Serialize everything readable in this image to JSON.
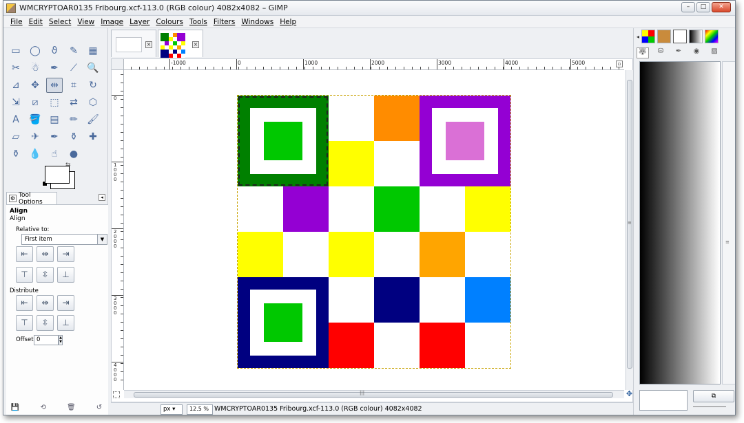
{
  "window": {
    "title": "WMCRYPTOAR0135 Fribourg.xcf-113.0 (RGB colour) 4082x4082 – GIMP",
    "controls": {
      "minimize": "–",
      "maximize": "□",
      "close": "✕"
    }
  },
  "menubar": {
    "items": [
      "File",
      "Edit",
      "Select",
      "View",
      "Image",
      "Layer",
      "Colours",
      "Tools",
      "Filters",
      "Windows",
      "Help"
    ]
  },
  "toolbox": {
    "tools": [
      "rect-select-icon",
      "ellipse-select-icon",
      "lasso-icon",
      "fuzzy-select-icon",
      "select-by-color-icon",
      "scissors-icon",
      "foreground-select-icon",
      "paths-icon",
      "color-picker-icon",
      "zoom-icon",
      "measure-icon",
      "move-icon",
      "align-icon",
      "crop-icon",
      "rotate-icon",
      "scale-icon",
      "shear-icon",
      "perspective-icon",
      "flip-icon",
      "cage-icon",
      "text-icon",
      "bucket-fill-icon",
      "blend-icon",
      "pencil-icon",
      "paintbrush-icon",
      "eraser-icon",
      "airbrush-icon",
      "ink-icon",
      "clone-icon",
      "heal-icon",
      "perspective-clone-icon",
      "blur-icon",
      "smudge-icon",
      "dodge-burn-icon"
    ],
    "tool_glyphs": [
      "▭",
      "◯",
      "ϑ",
      "✎",
      "▦",
      "✂",
      "☃",
      "✒",
      "⟋",
      "🔍",
      "⊿",
      "✥",
      "⇹",
      "⌗",
      "↻",
      "⇲",
      "⧄",
      "⬚",
      "⇄",
      "⬡",
      "A",
      "🪣",
      "▤",
      "✏",
      "🖌",
      "▱",
      "✈",
      "✒",
      "⚱",
      "✚",
      "⚱",
      "💧",
      "☝",
      "●"
    ],
    "active_tool_index": 12,
    "colors": {
      "foreground": "#ffffff",
      "background": "#ffffff"
    }
  },
  "tool_options": {
    "tab_label": "Tool Options",
    "title": "Align",
    "section": "Align",
    "relative_to_label": "Relative to:",
    "relative_to_value": "First item",
    "align_buttons_row1": [
      "⇤",
      "⇹",
      "⇥"
    ],
    "align_buttons_row2": [
      "⊤",
      "⇳",
      "⊥"
    ],
    "distribute_label": "Distribute",
    "distribute_buttons_row1": [
      "⇤",
      "⇹",
      "⇥"
    ],
    "distribute_buttons_row2": [
      "⊤",
      "⇳",
      "⊥"
    ],
    "offset_label": "Offset:",
    "offset_value": "0",
    "bottom_icons": [
      "save-icon",
      "restore-icon",
      "delete-icon",
      "reset-icon"
    ],
    "bottom_glyphs": [
      "💾",
      "⟲",
      "🗑",
      "↺"
    ]
  },
  "image_tabs": [
    {
      "label": "blank image tab"
    },
    {
      "label": "checker image tab",
      "active": true
    }
  ],
  "ruler": {
    "h_labels": [
      "-1000",
      "0",
      "1000",
      "2000",
      "3000",
      "4000",
      "5000"
    ],
    "v_labels": [
      "0",
      "1000",
      "2000",
      "3000",
      "4000"
    ]
  },
  "canvas": {
    "grid_colors": [
      [
        "#008000",
        "#008000",
        "#ffffff",
        "#ff8c00",
        "#9400d3",
        "#9400d3"
      ],
      [
        "#008000",
        "#008000",
        "#ffff00",
        "#ffffff",
        "#9400d3",
        "#9400d3"
      ],
      [
        "#ffffff",
        "#9400d3",
        "#ffffff",
        "#00c800",
        "#ffffff",
        "#ffff00"
      ],
      [
        "#ffff00",
        "#ffffff",
        "#ffff00",
        "#ffffff",
        "#ffa500",
        "#ffffff"
      ],
      [
        "#000080",
        "#000080",
        "#ffffff",
        "#000080",
        "#ffffff",
        "#0080ff"
      ],
      [
        "#000080",
        "#000080",
        "#ff0000",
        "#ffffff",
        "#ff0000",
        "#ffffff"
      ]
    ],
    "squares": [
      {
        "outer": "#008000",
        "core": "#00c800",
        "selected": true
      },
      {
        "outer": "#9400d3",
        "core": "#da70d6",
        "selected": false
      },
      {
        "outer": "#000080",
        "core": "#00c800",
        "selected": false
      }
    ]
  },
  "statusbar": {
    "unit": "px",
    "zoom": "12.5 %",
    "message": "WMCRYPTOAR0135 Fribourg.xcf-113.0 (RGB colour) 4082x4082"
  },
  "dock": {
    "tab_icons": [
      "patterns-icon",
      "fonts-icon",
      "brushes-icon",
      "gradients-icon",
      "palettes-icon"
    ],
    "row2_icons": [
      "layers-icon",
      "channels-icon",
      "paths-icon",
      "colormap-icon",
      "histogram-icon"
    ],
    "row2_glyphs": [
      "🐺",
      "⛁",
      "✒",
      "◉",
      "▨"
    ],
    "gradient": {
      "start": "#000000",
      "end": "#ffffff"
    },
    "footer_button": "⧉"
  }
}
